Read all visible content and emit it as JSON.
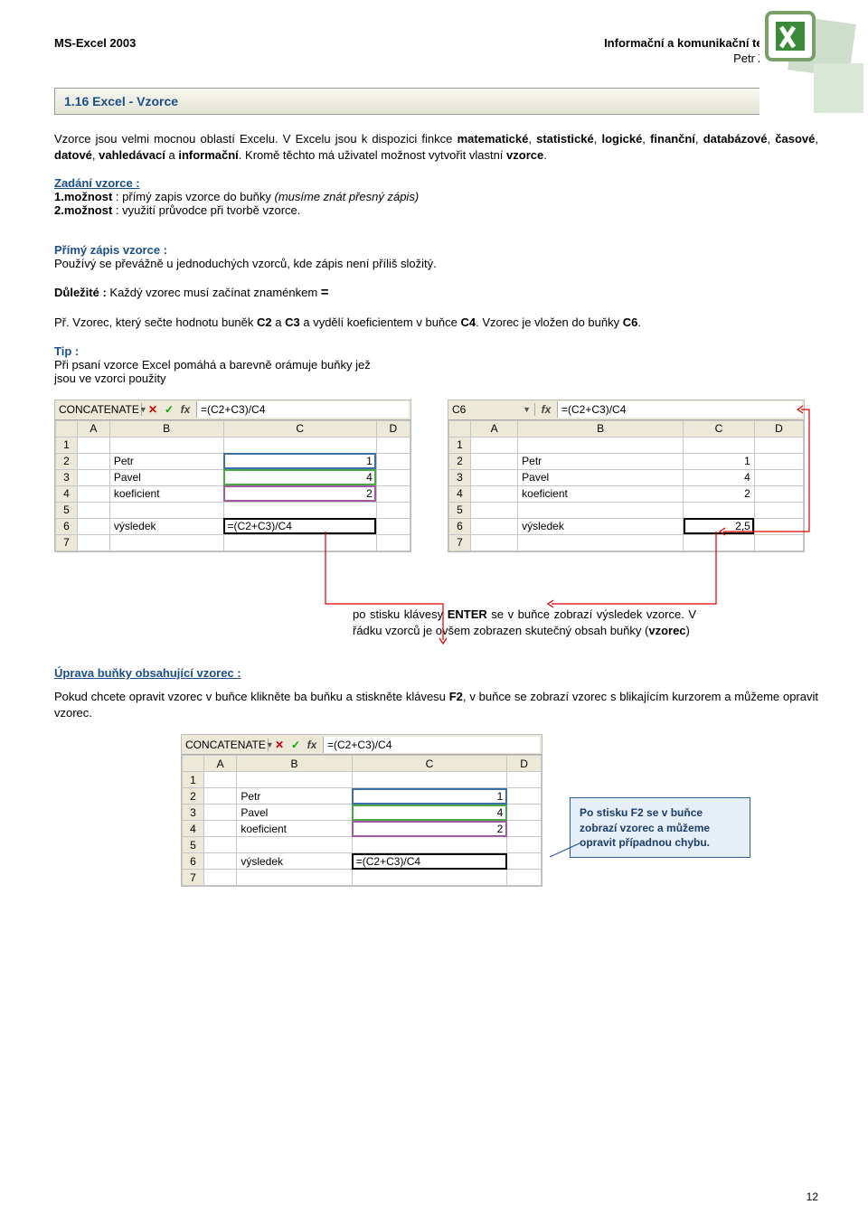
{
  "header": {
    "left": "MS-Excel 2003",
    "right": "Informační a komunikační technologie",
    "author": "Petr Zlatohlávek"
  },
  "title": "1.16 Excel - Vzorce",
  "intro": {
    "p1a": "Vzorce jsou velmi mocnou oblastí Excelu. V Excelu jsou k dispozici finkce ",
    "p1b_kw": [
      "matematické",
      "statistické",
      "logické",
      "finanční",
      "databázové",
      "časové",
      "datové",
      "vahledávací",
      "informační"
    ],
    "p1c": ". Kromě těchto má uživatel možnost vytvořit vlastní ",
    "p1d": "vzorce",
    "p1e": "."
  },
  "zadani": {
    "title": "Zadání vzorce :",
    "l1a": "1.možnost",
    "l1b": " : přímý zapis vzorce do buňky ",
    "l1c": "(musíme znát přesný zápis)",
    "l2a": "2.možnost",
    "l2b": " : využití průvodce při tvorbě vzorce."
  },
  "primy": {
    "title": "Přímý zápis vzorce :",
    "text": "Používý se převážně u jednoduchých vzorců, kde zápis není příliš složitý."
  },
  "dulezite": {
    "label": "Důležité :",
    "text": " Každý vzorec musí začínat znaménkem  ",
    "eq": "="
  },
  "example": {
    "p_a": "Př. Vzorec, který sečte hodnotu buněk ",
    "c2": "C2",
    "p_b": " a ",
    "c3": "C3",
    "p_c": " a vydělí koeficientem v buňce ",
    "c4": "C4",
    "p_d": ". Vzorec je vložen do buňky ",
    "c6": "C6",
    "p_e": "."
  },
  "tip": {
    "label": "Tip :",
    "text": "Při psaní vzorce Excel pomáhá a barevně orámuje buňky jež jsou ve vzorci použity"
  },
  "excel_left": {
    "namebox": "CONCATENATE",
    "formula": "=(C2+C3)/C4",
    "cols": [
      "A",
      "B",
      "C",
      "D"
    ],
    "rows": [
      "1",
      "2",
      "3",
      "4",
      "5",
      "6",
      "7"
    ],
    "b2": "Petr",
    "c2": "1",
    "b3": "Pavel",
    "c3": "4",
    "b4": "koeficient",
    "c4": "2",
    "b6": "výsledek",
    "c6": "=(C2+C3)/C4"
  },
  "excel_right": {
    "namebox": "C6",
    "formula": "=(C2+C3)/C4",
    "cols": [
      "A",
      "B",
      "C",
      "D"
    ],
    "rows": [
      "1",
      "2",
      "3",
      "4",
      "5",
      "6",
      "7"
    ],
    "b2": "Petr",
    "c2": "1",
    "b3": "Pavel",
    "c3": "4",
    "b4": "koeficient",
    "c4": "2",
    "b6": "výsledek",
    "c6": "2,5"
  },
  "caption": {
    "a": "po stisku klávesy ",
    "enter": "ENTER",
    "b": " se v buňce zobrazí výsledek vzorce. V řádku vzorců je ovšem zobrazen skutečný obsah buňky (",
    "vz": "vzorec",
    "c": ")"
  },
  "uprava": {
    "title": "Úprava buňky obsahující vzorec :",
    "p_a": "Pokud chcete opravit vzorec v buňce klikněte ba buňku a stiskněte klávesu ",
    "f2": "F2",
    "p_b": ", v buňce se zobrazí vzorec s blikajícím kurzorem a můžeme opravit vzorec."
  },
  "callout": "Po stisku F2 se v buňce zobrazí vzorec a můžeme opravit případnou chybu.",
  "page_number": "12",
  "icons": {
    "excel": "excel-icon",
    "dropdown": "▼",
    "cancel": "✕",
    "confirm": "✓",
    "fx": "fx"
  }
}
